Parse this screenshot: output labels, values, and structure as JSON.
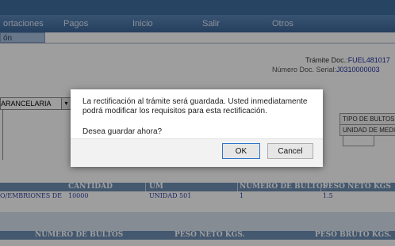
{
  "menu": {
    "items": [
      "ortaciones",
      "Pagos",
      "Inicio",
      "Salir",
      "Otros"
    ]
  },
  "subtab": {
    "label": "ón Requisitos"
  },
  "tramite": {
    "label": "Trámite Doc.:",
    "value": "FUEL481017"
  },
  "numero": {
    "label": "Número Doc. Serial:",
    "value": "J0310000003"
  },
  "form": {
    "select_value": "ARANCELARIA",
    "right_headers": [
      "TIPO DE BULTOS",
      "UNIDAD DE MEDI"
    ]
  },
  "grid1": {
    "headers": [
      "CANTIDAD",
      "UM",
      "NÚMERO DE BULTOS",
      "PESO NETO KGS"
    ],
    "row": [
      "O/EMBRIONES DE",
      "10000",
      "UNIDAD 501",
      "1",
      "1.5"
    ]
  },
  "grid2": {
    "headers": [
      "NÚMERO DE BULTOS",
      "PESO NETO KGS.",
      "PESO BRUTO KGS."
    ]
  },
  "dialog": {
    "message": "La rectificación al trámite será guardada. Usted inmediatamente podrá modificar los requisitos para esta rectificación.",
    "question": "Desea guardar ahora?",
    "ok_label": "OK",
    "cancel_label": "Cancel"
  },
  "colors": {
    "menu": "#4a74a8",
    "grid_header": "#6f8fb4",
    "link_text": "#2c3ea0",
    "ok_border": "#2a74cc"
  }
}
